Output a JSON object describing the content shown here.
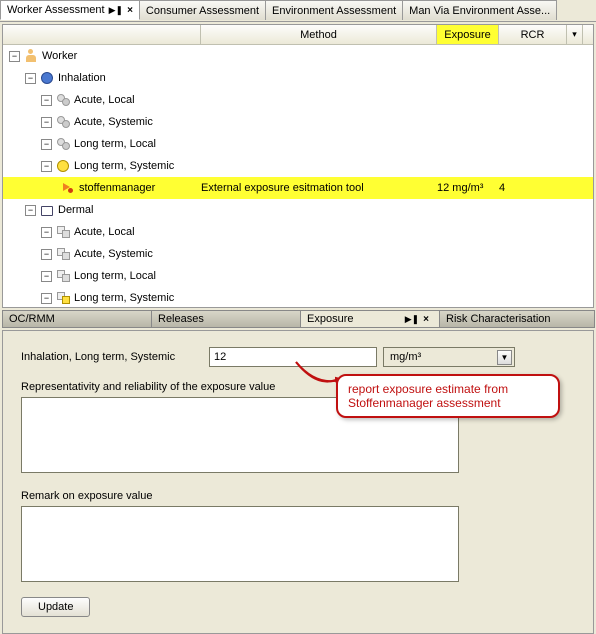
{
  "tabs": {
    "t0": "Worker Assessment",
    "t1": "Consumer Assessment",
    "t2": "Environment Assessment",
    "t3": "Man Via Environment Asse..."
  },
  "cols": {
    "method": "Method",
    "exposure": "Exposure",
    "rcr": "RCR"
  },
  "tree": {
    "worker": "Worker",
    "inhalation": "Inhalation",
    "acute_local": "Acute, Local",
    "acute_systemic": "Acute, Systemic",
    "long_local": "Long term, Local",
    "long_systemic": "Long term, Systemic",
    "tool_name": "stoffenmanager",
    "tool_method": "External exposure esitmation tool",
    "tool_exp": "12 mg/m³",
    "tool_rcr": "4",
    "dermal": "Dermal"
  },
  "subtabs": {
    "ocrmm": "OC/RMM",
    "releases": "Releases",
    "exposure": "Exposure",
    "risk": "Risk Characterisation"
  },
  "form": {
    "path_label": "Inhalation, Long term, Systemic",
    "value": "12",
    "unit": "mg/m³",
    "rep_label": "Representativity and reliability of the exposure value",
    "rep_value": "",
    "remark_label": "Remark on exposure value",
    "remark_value": "",
    "update": "Update"
  },
  "callout": "report exposure estimate from Stoffenmanager assessment"
}
